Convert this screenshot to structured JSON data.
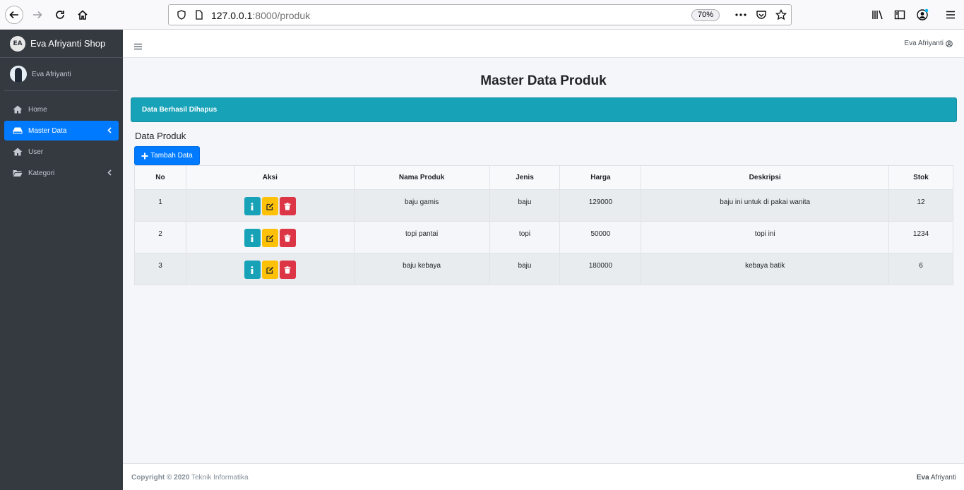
{
  "browser": {
    "url_host": "127.0.0.1",
    "url_path": ":8000/produk",
    "zoom": "70%"
  },
  "sidebar": {
    "brand_logo": "EA",
    "brand": "Eva Afriyanti Shop",
    "user": "Eva Afriyanti",
    "items": [
      {
        "label": "Home",
        "icon": "home-icon"
      },
      {
        "label": "Master Data",
        "icon": "drive-icon",
        "active": true
      },
      {
        "label": "User",
        "icon": "home-icon"
      },
      {
        "label": "Kategori",
        "icon": "folder-icon"
      }
    ]
  },
  "topnav": {
    "user": "Eva Afriyanti"
  },
  "page": {
    "title": "Master Data Produk",
    "alert": "Data Berhasil Dihapus",
    "section_title": "Data Produk",
    "add_button": "Tambah Data"
  },
  "table": {
    "headers": [
      "No",
      "Aksi",
      "Nama Produk",
      "Jenis",
      "Harga",
      "Deskripsi",
      "Stok"
    ],
    "rows": [
      {
        "no": "1",
        "nama": "baju gamis",
        "jenis": "baju",
        "harga": "129000",
        "deskripsi": "baju ini untuk di pakai wanita",
        "stok": "12"
      },
      {
        "no": "2",
        "nama": "topi pantai",
        "jenis": "topi",
        "harga": "50000",
        "deskripsi": "topi ini",
        "stok": "1234"
      },
      {
        "no": "3",
        "nama": "baju kebaya",
        "jenis": "baju",
        "harga": "180000",
        "deskripsi": "kebaya batik",
        "stok": "6"
      }
    ]
  },
  "footer": {
    "copyright": "Copyright © 2020",
    "org": "Teknik Informatika",
    "right_bold": "Eva",
    "right": "Afriyanti"
  },
  "colors": {
    "sidebar": "#343a40",
    "primary": "#007bff",
    "info": "#17a2b8",
    "warning": "#ffc107",
    "danger": "#dc3545"
  }
}
